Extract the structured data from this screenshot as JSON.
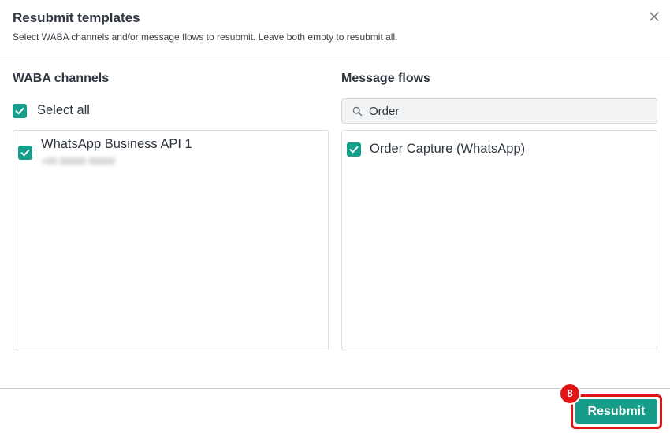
{
  "dialog": {
    "title": "Resubmit templates",
    "subtitle": "Select WABA channels and/or message flows to resubmit. Leave both empty to resubmit all."
  },
  "channels": {
    "heading": "WABA channels",
    "select_all_label": "Select all",
    "items": [
      {
        "name": "WhatsApp Business API 1",
        "phone": "+00 00000 00000",
        "checked": true
      }
    ]
  },
  "flows": {
    "heading": "Message flows",
    "search_value": "Order",
    "items": [
      {
        "name": "Order Capture (WhatsApp)",
        "checked": true
      }
    ]
  },
  "footer": {
    "resubmit_label": "Resubmit",
    "step_badge": "8"
  },
  "colors": {
    "accent": "#159e8c",
    "highlight": "#e01515"
  }
}
